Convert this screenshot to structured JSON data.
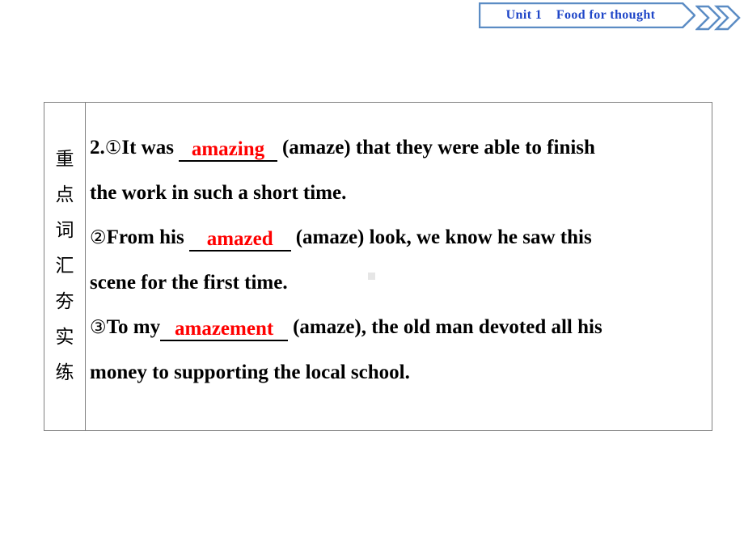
{
  "header": {
    "unit_label": "Unit 1",
    "title": "Food for thought",
    "full_text": "Unit 1    Food for thought",
    "border_color": "#5b8cc4",
    "text_color": "#1f46c8",
    "chevron_icon": "double-chevron-right-icon"
  },
  "sidebar": {
    "vertical_text": "重点词汇夯实练",
    "chars": [
      "重",
      "点",
      "词",
      "汇",
      "夯",
      "实",
      "练"
    ]
  },
  "exercise": {
    "number": "2.",
    "answer_color": "#ff0000",
    "items": [
      {
        "marker": "①",
        "before": "It was",
        "answer": "amazing",
        "after": "(amaze) that they were able to finish",
        "continuation": "the work in such a short time.",
        "hint": "amaze"
      },
      {
        "marker": "②",
        "before": "From his",
        "answer": "amazed",
        "after": "(amaze) look, we know he saw this",
        "continuation": "scene for the first time.",
        "hint": "amaze"
      },
      {
        "marker": "③",
        "before": "To my",
        "answer": "amazement",
        "after": "(amaze), the old man devoted all his",
        "continuation": "money to supporting the local school.",
        "hint": "amaze"
      }
    ]
  }
}
